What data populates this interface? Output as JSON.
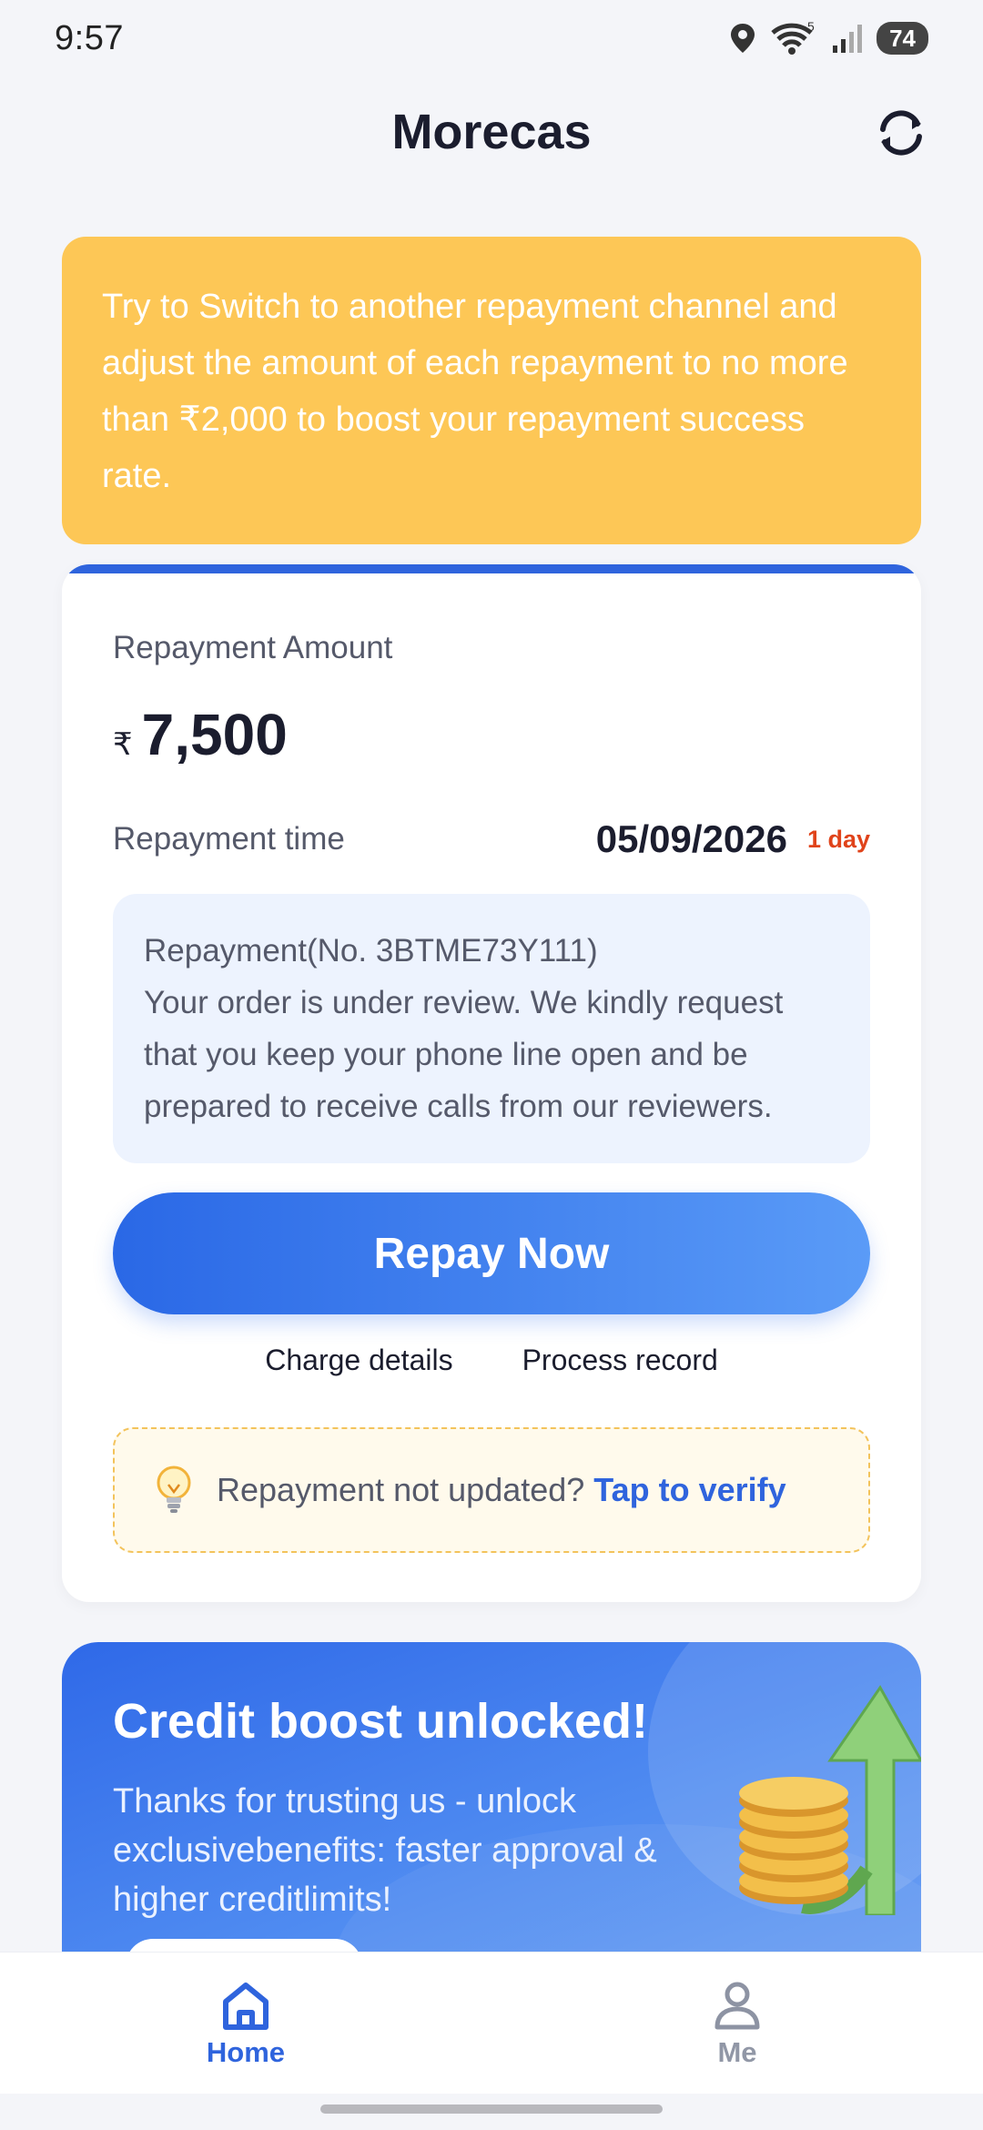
{
  "status_bar": {
    "time": "9:57",
    "battery": "74",
    "wifi_badge": "5"
  },
  "header": {
    "title": "Morecas"
  },
  "notice": {
    "text": "Try to Switch to another repayment channel and adjust the amount of each repayment to no more than ₹2,000 to boost your repayment success rate."
  },
  "repayment": {
    "amount_label": "Repayment Amount",
    "currency_symbol": "₹",
    "amount": "7,500",
    "time_label": "Repayment time",
    "time_value": "05/09/2026",
    "days_left": "1 day",
    "order_lines": [
      "Repayment(No. 3BTME73Y111)",
      "Your order is under review. We kindly request",
      "that you keep your phone line open and be",
      "prepared to receive calls from our reviewers."
    ],
    "repay_button": "Repay Now",
    "charge_details": "Charge details",
    "process_record": "Process record",
    "verify_prompt": "Repayment not updated?",
    "verify_link": "Tap to verify"
  },
  "boost": {
    "title": "Credit boost unlocked!",
    "description": "Thanks for trusting us - unlock exclusivebenefits: faster approval & higher creditlimits!"
  },
  "bottom_nav": {
    "items": [
      {
        "label": "Home",
        "icon": "home-icon",
        "active": true
      },
      {
        "label": "Me",
        "icon": "person-icon",
        "active": false
      }
    ]
  },
  "colors": {
    "primary": "#2f64dd",
    "notice_bg": "#fdc756",
    "alert": "#e0431a"
  }
}
